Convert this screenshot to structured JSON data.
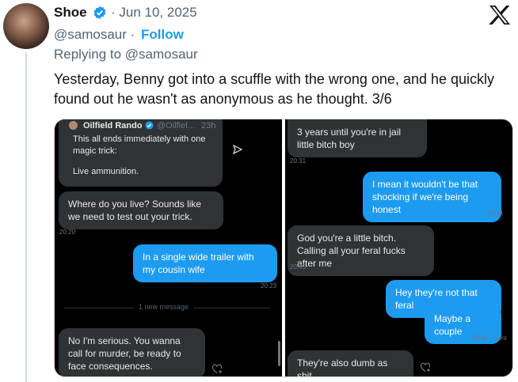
{
  "tweet": {
    "author_name": "Shoe",
    "date": "· Jun 10, 2025",
    "handle": "@samosaur ·",
    "follow_label": "Follow",
    "replying_to": "Replying to @samosaur",
    "text": "Yesterday, Benny got into a scuffle with the wrong one, and he quickly found out he wasn't as anonymous as he thought. 3/6",
    "icons": {
      "verified": "verified-badge-icon",
      "brand": "x-logo-icon"
    },
    "colors": {
      "accent": "#1d9bf0",
      "muted": "#536471",
      "text": "#0f1419"
    }
  },
  "left_screenshot": {
    "quoted_card": {
      "name": "Oilfield Rando",
      "handle": "@Oilfiel...",
      "age": "23h",
      "body": "This all ends immediately with one magic trick:",
      "body2": "Live ammunition."
    },
    "messages": [
      {
        "text": "Where do you live? Sounds like we need to test out your trick.",
        "time": "20:20"
      },
      {
        "text": "In a single wide trailer with my cousin wife",
        "time": "20:23"
      },
      {
        "text": "No I'm serious. You wanna call for murder, be ready to face consequences."
      }
    ],
    "divider": "1 new message"
  },
  "right_screenshot": {
    "messages": [
      {
        "text": "3 years until you're in jail little bitch boy",
        "time": "20:31"
      },
      {
        "text": "I mean it wouldn't be that shocking if we're being honest",
        "time": "20:34"
      },
      {
        "text": "God you're a little bitch. Calling all your feral fucks after me",
        "time": "20:45"
      },
      {
        "text": "Hey they're not that feral"
      },
      {
        "text": "Maybe a couple",
        "time": "20:46 · Sent"
      },
      {
        "text": "They're also dumb as shit"
      }
    ]
  }
}
